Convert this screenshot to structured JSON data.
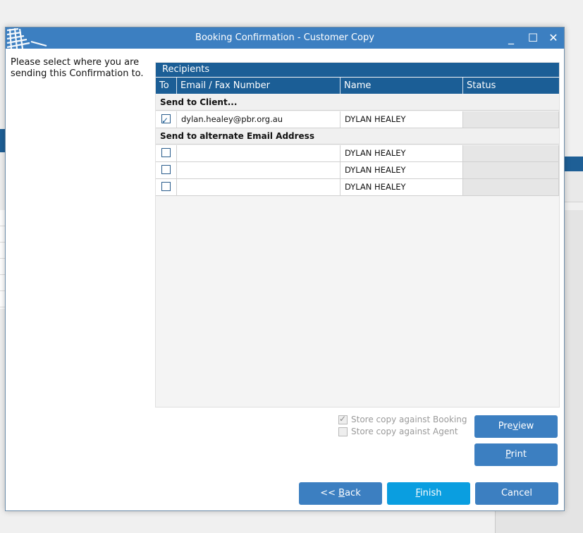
{
  "dialog": {
    "title": "Booking Confirmation - Customer Copy",
    "instruction": "Please select where you are sending this Confirmation to."
  },
  "window_controls": {
    "minimize": "_",
    "maximize": "☐",
    "close": "✕"
  },
  "recipients": {
    "caption": "Recipients",
    "columns": [
      "To",
      "Email / Fax Number",
      "Name",
      "Status"
    ],
    "groups": [
      {
        "label": "Send to Client...",
        "rows": [
          {
            "checked": true,
            "email": "dylan.healey@pbr.org.au",
            "name": "DYLAN HEALEY",
            "status": ""
          }
        ]
      },
      {
        "label": "Send to alternate Email Address",
        "rows": [
          {
            "checked": false,
            "email": "",
            "name": "DYLAN HEALEY",
            "status": ""
          },
          {
            "checked": false,
            "email": "",
            "name": "DYLAN HEALEY",
            "status": ""
          },
          {
            "checked": false,
            "email": "",
            "name": "DYLAN HEALEY",
            "status": ""
          }
        ]
      }
    ]
  },
  "options": {
    "store_booking": {
      "label": "Store copy against Booking",
      "checked": true
    },
    "store_agent": {
      "label": "Store copy against Agent",
      "checked": false
    }
  },
  "buttons": {
    "preview": {
      "pre": "Pre",
      "key": "v",
      "post": "iew"
    },
    "print": {
      "pre": "",
      "key": "P",
      "post": "rint"
    },
    "back": {
      "pre": "<< ",
      "key": "B",
      "post": "ack"
    },
    "finish": {
      "pre": "",
      "key": "F",
      "post": "inish"
    },
    "cancel": {
      "label": "Cancel"
    }
  },
  "colors": {
    "accent": "#3c7fc1",
    "header": "#1b5e96",
    "finish": "#0a9ee0"
  }
}
